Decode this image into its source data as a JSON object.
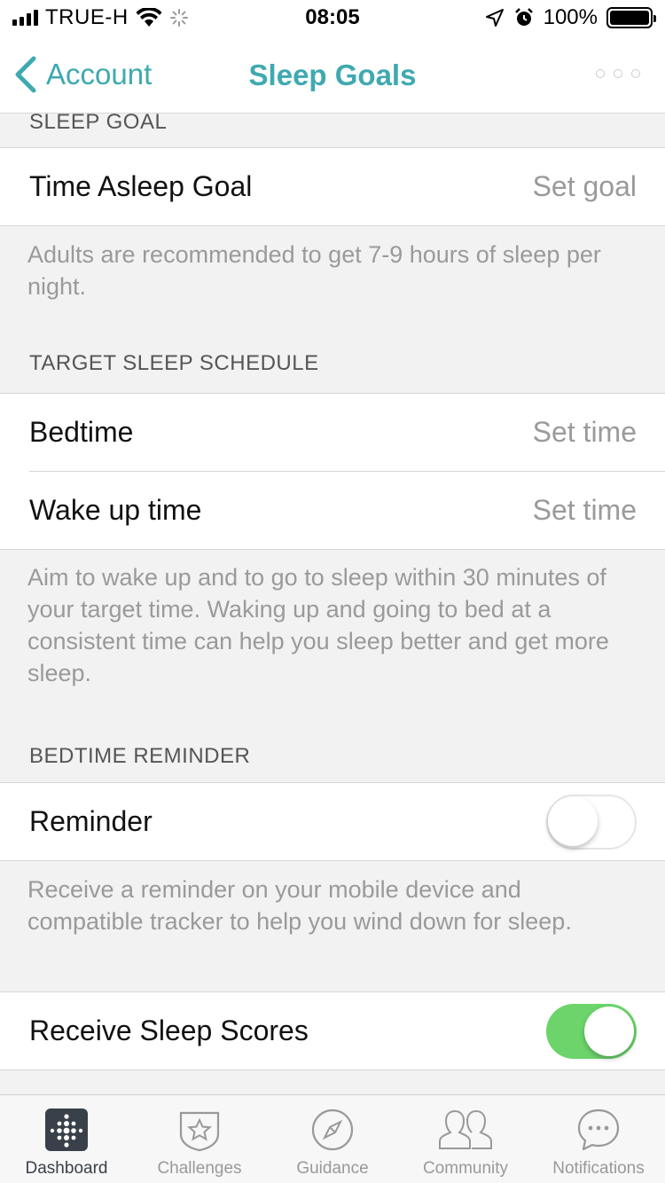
{
  "status_bar": {
    "carrier": "TRUE-H",
    "time": "08:05",
    "battery": "100%"
  },
  "nav": {
    "back_label": "Account",
    "title": "Sleep Goals"
  },
  "sections": {
    "sleep_goal": {
      "header": "SLEEP GOAL",
      "row_label": "Time Asleep Goal",
      "row_value": "Set goal",
      "footnote": "Adults are recommended to get 7-9 hours of sleep per night."
    },
    "schedule": {
      "header": "TARGET SLEEP SCHEDULE",
      "bedtime_label": "Bedtime",
      "bedtime_value": "Set time",
      "wake_label": "Wake up time",
      "wake_value": "Set time",
      "footnote": "Aim to wake up and to go to sleep within 30 minutes of your target time. Waking up and going to bed at a consistent time can help you sleep better and get more sleep."
    },
    "reminder": {
      "header": "BEDTIME REMINDER",
      "row_label": "Reminder",
      "toggle_on": false,
      "footnote": "Receive a reminder on your mobile device and compatible tracker to help you wind down for sleep."
    },
    "scores": {
      "row_label": "Receive Sleep Scores",
      "toggle_on": true
    }
  },
  "tab_bar": {
    "tabs": [
      {
        "label": "Dashboard",
        "icon": "dashboard-icon",
        "active": true
      },
      {
        "label": "Challenges",
        "icon": "star-badge-icon",
        "active": false
      },
      {
        "label": "Guidance",
        "icon": "compass-icon",
        "active": false
      },
      {
        "label": "Community",
        "icon": "people-icon",
        "active": false
      },
      {
        "label": "Notifications",
        "icon": "chat-bubble-icon",
        "active": false
      }
    ]
  },
  "colors": {
    "accent": "#3fa9b0",
    "toggle_on": "#6cd46a"
  }
}
